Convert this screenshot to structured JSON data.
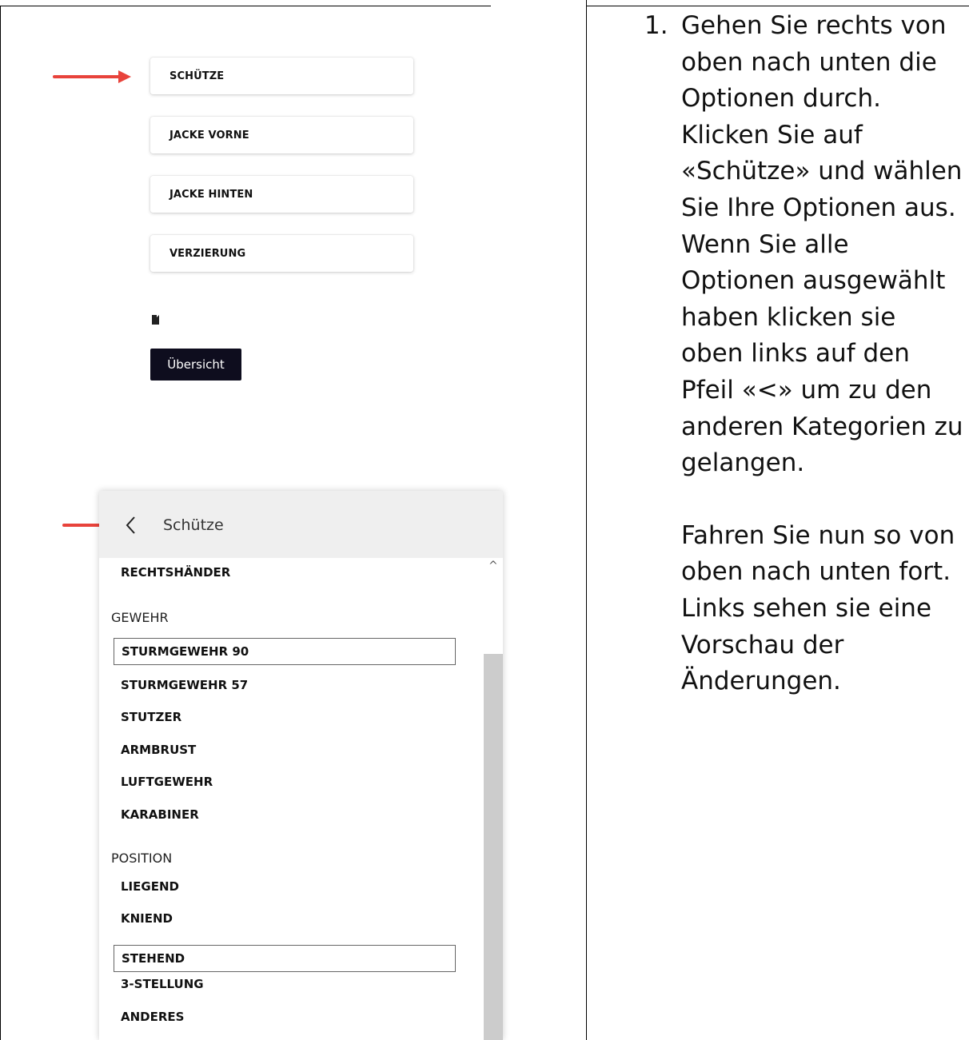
{
  "options": [
    "SCHÜTZE",
    "JACKE VORNE",
    "JACKE HINTEN",
    "VERZIERUNG"
  ],
  "overview_label": "Übersicht",
  "panel": {
    "title": "Schütze",
    "items": {
      "rechtshaender": "RECHTSHÄNDER",
      "gewehr_header": "GEWEHR",
      "sturmgewehr90": "STURMGEWEHR 90",
      "sturmgewehr57": "STURMGEWEHR 57",
      "stutzer": "STUTZER",
      "armbrust": "ARMBRUST",
      "luftgewehr": "LUFTGEWEHR",
      "karabiner": "KARABINER",
      "position_header": "POSITION",
      "liegend": "LIEGEND",
      "kniend": "KNIEND",
      "stehend": "STEHEND",
      "stellung3": "3-STELLUNG",
      "anderes": "ANDERES"
    }
  },
  "instructions": {
    "number": "1.",
    "paragraph1": "Gehen Sie rechts von oben nach unten die Optionen durch. Klicken Sie auf «Schütze» und wählen Sie Ihre Optionen aus. Wenn Sie alle Optionen ausgewählt haben klicken sie oben links auf den Pfeil «<» um zu den anderen Kategorien zu gelangen.",
    "paragraph2": "Fahren Sie nun so von oben nach unten fort. Links sehen sie eine Vorschau der Änderungen."
  },
  "colors": {
    "arrow": "#e8433b",
    "overview_bg": "#0e0d1e",
    "panel_header": "#efefef",
    "scroll_thumb": "#cccccc"
  }
}
